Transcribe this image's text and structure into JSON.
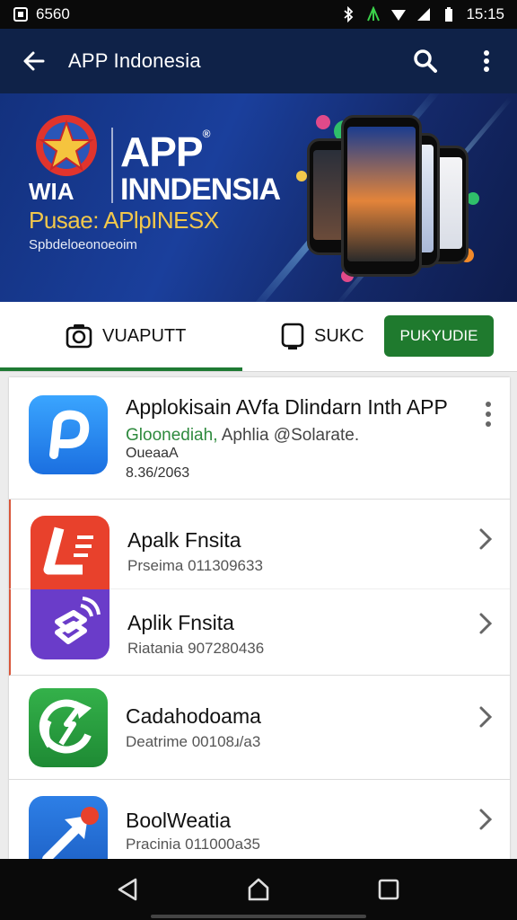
{
  "status_bar": {
    "left_text": "6560",
    "time": "15:15"
  },
  "toolbar": {
    "title": "APP Indonesia",
    "icons": [
      "back-arrow-icon",
      "search-icon",
      "more-vert-icon"
    ]
  },
  "banner": {
    "title_line1": "APP",
    "title_line1_mark": "®",
    "title_line2": "INNDENSIA",
    "logo_text": "WIA",
    "tagline": "Pusae: APlpINESX",
    "subtitle": "Spbdeloeonoeoim"
  },
  "tabs": {
    "items": [
      {
        "label": "VUAPUTT",
        "icon": "camera-icon",
        "selected": true
      },
      {
        "label": "SUKC",
        "icon": "phone-icon",
        "selected": false
      }
    ],
    "action_label": "PUKYUDIE",
    "accent_color": "#1f7a2e"
  },
  "list": {
    "featured": {
      "title": "Applokisain AVfa Dlindarn Inth APP",
      "developer": "Gloonediah,",
      "developer_rest": " Aphlia @Solarate.",
      "category": "OueaaA",
      "date": "8.36/2063",
      "icon": "blue-p-app-icon"
    },
    "items": [
      {
        "title": "Apalk Fnsita",
        "sub_prefix": "Prseima",
        "sub_num": "011309633",
        "icon": "red-l-app-icon"
      },
      {
        "title": "Aplik Fnsita",
        "sub_prefix": "Riatania",
        "sub_num": "907280436",
        "icon": "purple-wifi-app-icon"
      },
      {
        "title": "Cadahodoama",
        "sub_prefix": "Deatrime",
        "sub_num": "00108ɹ/a3",
        "icon": "green-sync-app-icon"
      },
      {
        "title": "BoolWeatia",
        "sub_prefix": "Pracinia",
        "sub_num": "011000a35",
        "icon": "blue-arrow-app-icon"
      }
    ]
  },
  "navbar": {
    "icons": [
      "back-triangle-icon",
      "home-icon",
      "recents-icon"
    ]
  }
}
